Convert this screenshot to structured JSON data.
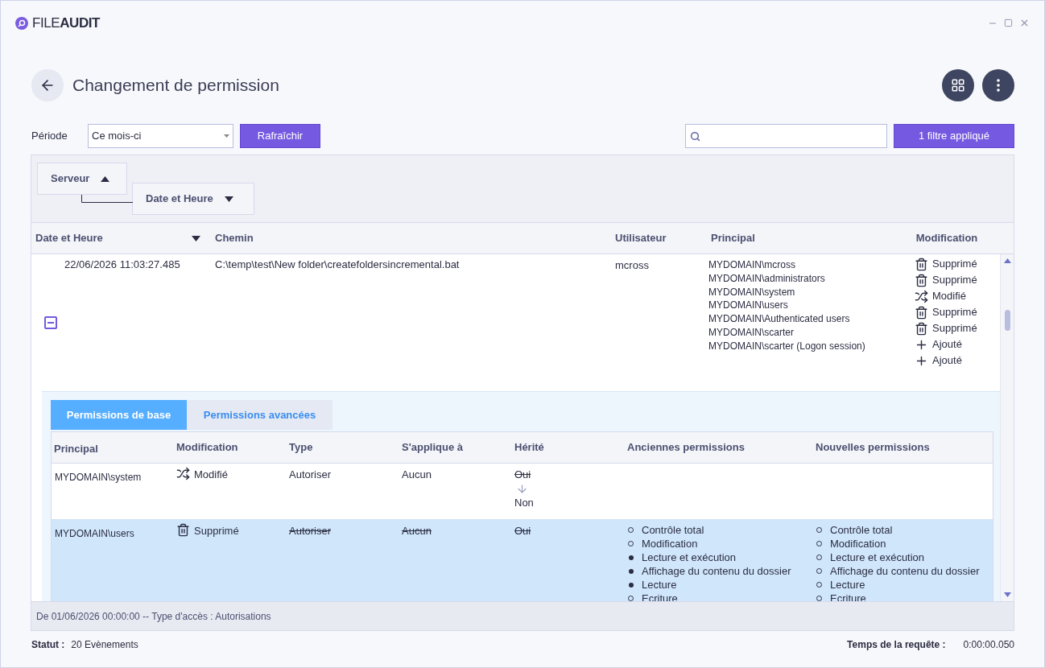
{
  "app": {
    "logo_light": "FILE",
    "logo_bold": "AUDIT"
  },
  "page": {
    "title": "Changement de permission"
  },
  "toolbar": {
    "period_label": "Période",
    "period_value": "Ce mois-ci",
    "refresh": "Rafraîchir",
    "filter_button": "1 filtre appliqué"
  },
  "grouping": [
    {
      "label": "Serveur",
      "ascending": true
    },
    {
      "label": "Date et Heure",
      "ascending": false
    }
  ],
  "table": {
    "columns": [
      {
        "label": "Date et Heure",
        "ascending": false
      },
      {
        "label": "Chemin"
      },
      {
        "label": "Utilisateur"
      },
      {
        "label": "Principal"
      },
      {
        "label": "Modification"
      }
    ],
    "rows": [
      {
        "date": "22/06/2026 11:03:27.485",
        "path": "C:\\temp\\test\\New folder\\createfoldersincremental.bat",
        "user": "mcross",
        "expanded": true,
        "principals": [
          "MYDOMAIN\\mcross",
          "MYDOMAIN\\administrators",
          "MYDOMAIN\\system",
          "MYDOMAIN\\users",
          "MYDOMAIN\\Authenticated users",
          "MYDOMAIN\\scarter",
          "MYDOMAIN\\scarter (Logon session)"
        ],
        "modifications": [
          {
            "kind": "deleted",
            "label": "Supprimé"
          },
          {
            "kind": "deleted",
            "label": "Supprimé"
          },
          {
            "kind": "modified",
            "label": "Modifié"
          },
          {
            "kind": "deleted",
            "label": "Supprimé"
          },
          {
            "kind": "deleted",
            "label": "Supprimé"
          },
          {
            "kind": "added",
            "label": "Ajouté"
          },
          {
            "kind": "added",
            "label": "Ajouté"
          }
        ]
      }
    ]
  },
  "detail": {
    "tabs": [
      {
        "label": "Permissions de base",
        "selected": true
      },
      {
        "label": "Permissions avancées",
        "selected": false
      }
    ],
    "columns": [
      "Principal",
      "Modification",
      "Type",
      "S'applique à",
      "Hérité",
      "Anciennes permissions",
      "Nouvelles permissions"
    ],
    "rows": [
      {
        "principal": "MYDOMAIN\\system",
        "selected": false,
        "modification": {
          "kind": "modified",
          "label": "Modifié"
        },
        "type": {
          "text": "Autoriser",
          "struck": false
        },
        "applies_to": {
          "text": "Aucun",
          "struck": false
        },
        "inherited": {
          "old": "Oui",
          "new": "Non"
        },
        "old_permissions": [],
        "new_permissions": []
      },
      {
        "principal": "MYDOMAIN\\users",
        "selected": true,
        "modification": {
          "kind": "deleted",
          "label": "Supprimé"
        },
        "type": {
          "text": "Autoriser",
          "struck": true
        },
        "applies_to": {
          "text": "Aucun",
          "struck": true
        },
        "inherited": {
          "old": "Oui"
        },
        "old_permissions": [
          {
            "label": "Contrôle total",
            "granted": false
          },
          {
            "label": "Modification",
            "granted": false
          },
          {
            "label": "Lecture et exécution",
            "granted": true
          },
          {
            "label": "Affichage du contenu du dossier",
            "granted": true
          },
          {
            "label": "Lecture",
            "granted": true
          },
          {
            "label": "Ecriture",
            "granted": false
          }
        ],
        "new_permissions": [
          {
            "label": "Contrôle total",
            "granted": false
          },
          {
            "label": "Modification",
            "granted": false
          },
          {
            "label": "Lecture et exécution",
            "granted": false
          },
          {
            "label": "Affichage du contenu du dossier",
            "granted": false
          },
          {
            "label": "Lecture",
            "granted": false
          },
          {
            "label": "Ecriture",
            "granted": false
          }
        ]
      }
    ]
  },
  "footer": {
    "filter_summary": "De 01/06/2026 00:00:00 -- Type d'accès : Autorisations"
  },
  "status_bar": {
    "status_label": "Statut :",
    "status_value": "20 Evènements",
    "time_label": "Temps de la requête :",
    "time_value": "0:00:00.050"
  }
}
